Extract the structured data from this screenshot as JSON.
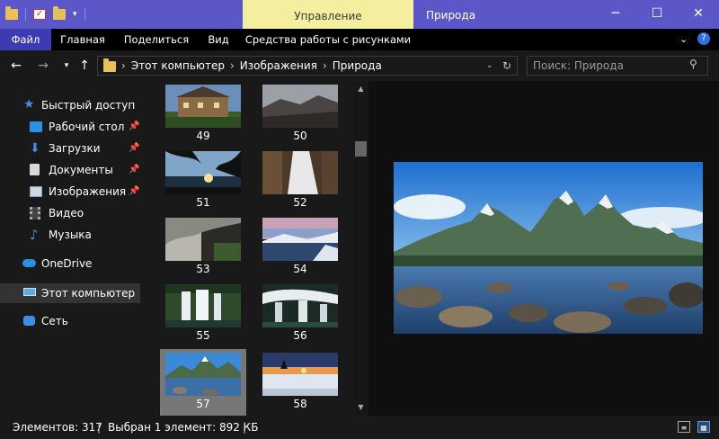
{
  "window": {
    "title": "Природа",
    "context_tab": "Управление"
  },
  "ribbon": {
    "tabs": [
      "Файл",
      "Главная",
      "Поделиться",
      "Вид",
      "Средства работы с рисунками"
    ]
  },
  "address": {
    "crumbs": [
      "Этот компьютер",
      "Изображения",
      "Природа"
    ]
  },
  "search": {
    "placeholder": "Поиск: Природа"
  },
  "sidebar": {
    "items": [
      {
        "label": "Быстрый доступ",
        "icon": "star-icon"
      },
      {
        "label": "Рабочий стол",
        "icon": "desktop-icon",
        "pinned": true
      },
      {
        "label": "Загрузки",
        "icon": "download-icon",
        "pinned": true
      },
      {
        "label": "Документы",
        "icon": "document-icon",
        "pinned": true
      },
      {
        "label": "Изображения",
        "icon": "pictures-icon",
        "pinned": true
      },
      {
        "label": "Видео",
        "icon": "video-icon"
      },
      {
        "label": "Музыка",
        "icon": "music-icon"
      },
      {
        "label": "OneDrive",
        "icon": "cloud-icon"
      },
      {
        "label": "Этот компьютер",
        "icon": "computer-icon",
        "selected": true
      },
      {
        "label": "Сеть",
        "icon": "network-icon"
      }
    ]
  },
  "thumbnails": [
    {
      "label": "49",
      "scene": "house"
    },
    {
      "label": "50",
      "scene": "valley"
    },
    {
      "label": "51",
      "scene": "sunset-tree"
    },
    {
      "label": "52",
      "scene": "waterfall-rock"
    },
    {
      "label": "53",
      "scene": "cave"
    },
    {
      "label": "54",
      "scene": "lake-dusk"
    },
    {
      "label": "55",
      "scene": "waterfall"
    },
    {
      "label": "56",
      "scene": "falls"
    },
    {
      "label": "57",
      "scene": "mountain-lake",
      "selected": true
    },
    {
      "label": "58",
      "scene": "sunset-snow"
    }
  ],
  "status": {
    "count": "Элементов: 317",
    "selection": "Выбран 1 элемент: 892 КБ"
  },
  "colors": {
    "titlebar": "#5b57c9",
    "context_tab": "#f4ef9f",
    "file_tab": "#3d3bb4",
    "background": "#191919"
  }
}
